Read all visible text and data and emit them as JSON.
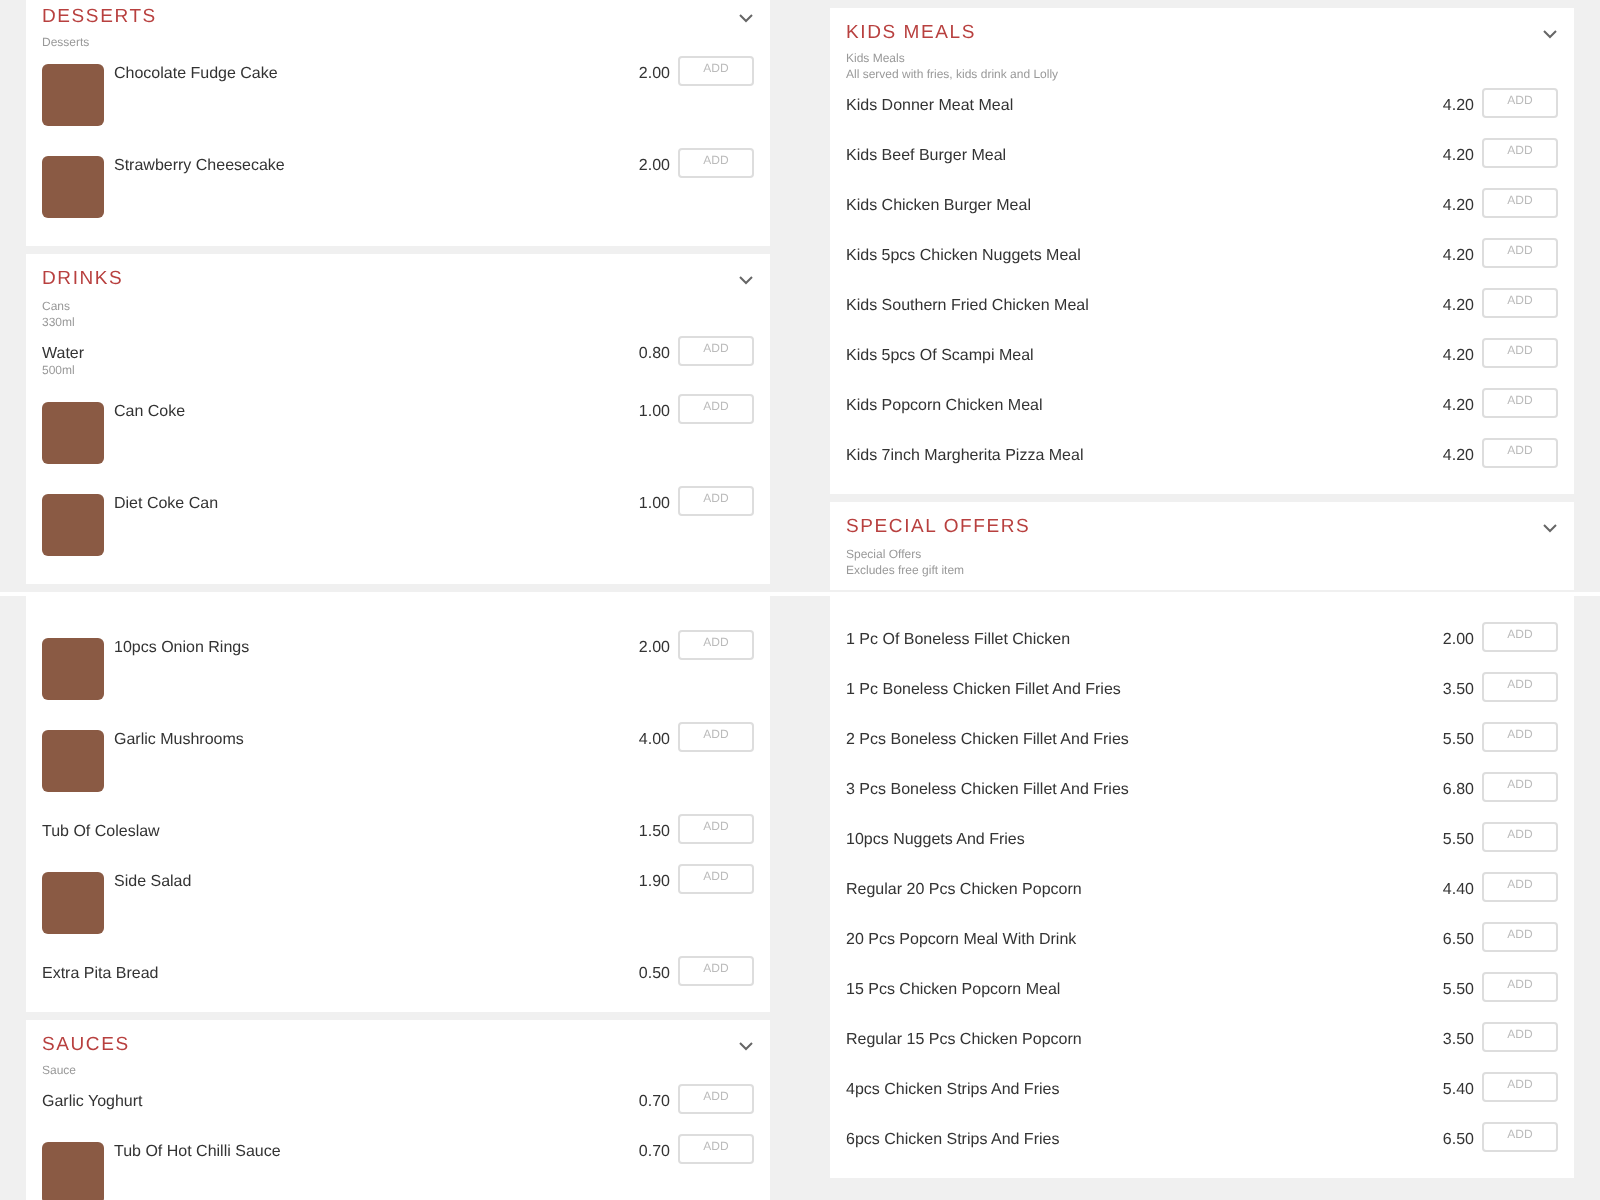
{
  "panes": [
    {
      "sections": [
        {
          "title": "DESSERTS",
          "notes": [
            "Desserts"
          ],
          "items": [
            {
              "name": "Chocolate Fudge Cake",
              "price": "2.00",
              "photo": true,
              "button": "ADD"
            },
            {
              "name": "Strawberry Cheesecake",
              "price": "2.00",
              "photo": true,
              "button": "ADD"
            }
          ]
        },
        {
          "title": "DRINKS",
          "notes": [
            "Cans",
            "330ml"
          ],
          "items": [
            {
              "name": "Water",
              "note": "500ml",
              "price": "0.80",
              "photo": false,
              "button": "ADD"
            },
            {
              "name": "Can Coke",
              "price": "1.00",
              "photo": true,
              "button": "ADD"
            },
            {
              "name": "Diet Coke Can",
              "price": "1.00",
              "photo": true,
              "button": "ADD"
            }
          ]
        }
      ]
    },
    {
      "sections": [
        {
          "title": "KIDS MEALS",
          "notes": [
            "Kids Meals",
            "All served with fries, kids drink and Lolly"
          ],
          "items": [
            {
              "name": "Kids Donner Meat Meal",
              "price": "4.20",
              "photo": false,
              "button": "ADD"
            },
            {
              "name": "Kids Beef Burger Meal",
              "price": "4.20",
              "photo": false,
              "button": "ADD"
            },
            {
              "name": "Kids Chicken Burger Meal",
              "price": "4.20",
              "photo": false,
              "button": "ADD"
            },
            {
              "name": "Kids 5pcs Chicken Nuggets Meal",
              "price": "4.20",
              "photo": false,
              "button": "ADD"
            },
            {
              "name": "Kids Southern Fried Chicken Meal",
              "price": "4.20",
              "photo": false,
              "button": "ADD"
            },
            {
              "name": "Kids 5pcs Of Scampi Meal",
              "price": "4.20",
              "photo": false,
              "button": "ADD"
            },
            {
              "name": "Kids Popcorn Chicken Meal",
              "price": "4.20",
              "photo": false,
              "button": "ADD"
            },
            {
              "name": "Kids 7inch Margherita Pizza Meal",
              "price": "4.20",
              "photo": false,
              "button": "ADD"
            }
          ]
        },
        {
          "title": "SPECIAL OFFERS",
          "notes": [
            "Special Offers",
            "Excludes free gift item"
          ]
        }
      ]
    },
    {
      "sections": [
        {
          "items": [
            {
              "name": "10pcs Onion Rings",
              "price": "2.00",
              "photo": true,
              "button": "ADD"
            },
            {
              "name": "Garlic Mushrooms",
              "price": "4.00",
              "photo": true,
              "button": "ADD"
            },
            {
              "name": "Tub Of Coleslaw",
              "price": "1.50",
              "photo": false,
              "button": "ADD"
            },
            {
              "name": "Side Salad",
              "price": "1.90",
              "photo": true,
              "button": "ADD"
            },
            {
              "name": "Extra Pita Bread",
              "price": "0.50",
              "photo": false,
              "button": "ADD"
            }
          ]
        },
        {
          "title": "SAUCES",
          "notes": [
            "Sauce"
          ],
          "items": [
            {
              "name": "Garlic Yoghurt",
              "price": "0.70",
              "photo": false,
              "button": "ADD"
            },
            {
              "name": "Tub Of Hot Chilli Sauce",
              "price": "0.70",
              "photo": true,
              "button": "ADD"
            }
          ]
        }
      ]
    },
    {
      "sections": [
        {
          "items": [
            {
              "name": "1 Pc Of Boneless Fillet Chicken",
              "price": "2.00",
              "photo": false,
              "button": "ADD"
            },
            {
              "name": "1 Pc Boneless Chicken Fillet And Fries",
              "price": "3.50",
              "photo": false,
              "button": "ADD"
            },
            {
              "name": "2 Pcs Boneless Chicken Fillet And Fries",
              "price": "5.50",
              "photo": false,
              "button": "ADD"
            },
            {
              "name": "3 Pcs Boneless Chicken Fillet And Fries",
              "price": "6.80",
              "photo": false,
              "button": "ADD"
            },
            {
              "name": "10pcs Nuggets And Fries",
              "price": "5.50",
              "photo": false,
              "button": "ADD"
            },
            {
              "name": "Regular 20 Pcs Chicken Popcorn",
              "price": "4.40",
              "photo": false,
              "button": "ADD"
            },
            {
              "name": "20 Pcs Popcorn Meal With Drink",
              "price": "6.50",
              "photo": false,
              "button": "ADD"
            },
            {
              "name": "15 Pcs Chicken Popcorn Meal",
              "price": "5.50",
              "photo": false,
              "button": "ADD"
            },
            {
              "name": "Regular 15 Pcs Chicken Popcorn",
              "price": "3.50",
              "photo": false,
              "button": "ADD"
            },
            {
              "name": "4pcs Chicken Strips And Fries",
              "price": "5.40",
              "photo": false,
              "button": "ADD"
            },
            {
              "name": "6pcs Chicken Strips And Fries",
              "price": "6.50",
              "photo": false,
              "button": "ADD"
            }
          ]
        }
      ]
    }
  ]
}
